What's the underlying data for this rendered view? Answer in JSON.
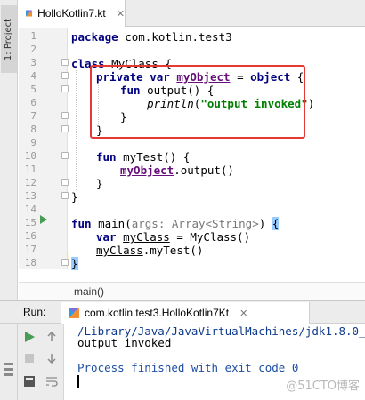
{
  "project_tab": {
    "label": "1: Project"
  },
  "editor": {
    "file_tab": {
      "name": "HolloKotlin7.kt"
    },
    "line_numbers": [
      "1",
      "2",
      "3",
      "4",
      "5",
      "6",
      "7",
      "8",
      "9",
      "10",
      "11",
      "12",
      "13",
      "14",
      "15",
      "16",
      "17",
      "18"
    ],
    "code": {
      "l1_kw": "package",
      "l1_rest": " com.kotlin.test3",
      "l3_kw": "class",
      "l3_rest": " MyClass {",
      "l4_kw": "private var",
      "l4_sp": " ",
      "l4_prop": "myObject",
      "l4_eq": " = ",
      "l4_kw2": "object",
      "l4_end": " {",
      "l5_kw": "fun",
      "l5_rest": " output() {",
      "l6_fn": "println",
      "l6_open": "(",
      "l6_str": "\"output invoked\"",
      "l6_close": ")",
      "l7": "}",
      "l8": "}",
      "l10_kw": "fun",
      "l10_rest": " myTest() {",
      "l11_prop": "myObject",
      "l11_rest": ".output()",
      "l12": "}",
      "l13": "}",
      "l15_kw": "fun",
      "l15_name": " main(",
      "l15_hint": "args: Array<String>",
      "l15_close": ") ",
      "l15_brace": "{",
      "l16_kw": "var",
      "l16_sp": " ",
      "l16_var": "myClass",
      "l16_rest": " = MyClass()",
      "l17_var": "myClass",
      "l17_rest": ".myTest()",
      "l18_brace": "}"
    },
    "breadcrumb": "main()"
  },
  "run_panel": {
    "label": "Run:",
    "tab_name": "com.kotlin.test3.HolloKotlin7Kt",
    "console": {
      "path_line": "/Library/Java/JavaVirtualMachines/jdk1.8.0_92.",
      "output_line": "output invoked",
      "exit_line": "Process finished with exit code 0"
    }
  },
  "watermark": "@51CTO博客",
  "colors": {
    "keyword": "#000080",
    "property": "#660e7a",
    "string": "#008000",
    "highlight_box": "#e53935",
    "run_green": "#499c54"
  }
}
